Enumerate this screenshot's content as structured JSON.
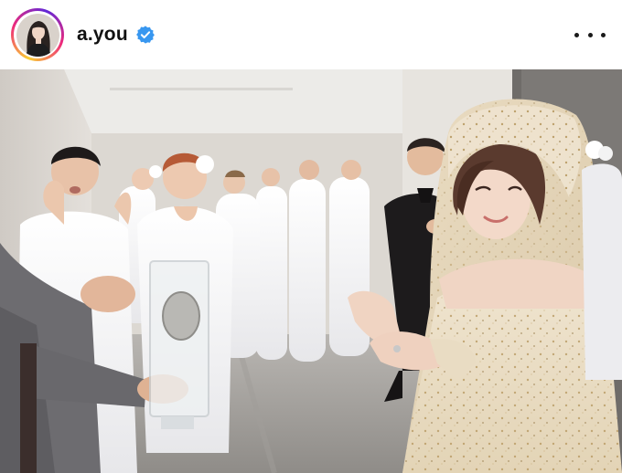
{
  "post": {
    "username": "a.you",
    "verified": true,
    "avatar_icon": "profile-photo-avatar",
    "verified_icon": "verified-badge-icon",
    "more_icon": "more-options-icon",
    "story_ring_colors": [
      "#f9ce34",
      "#ee2a7b",
      "#6228d7"
    ],
    "verified_color": "#3897f0"
  },
  "photo": {
    "description_icon": "wedding-dress-photo"
  }
}
